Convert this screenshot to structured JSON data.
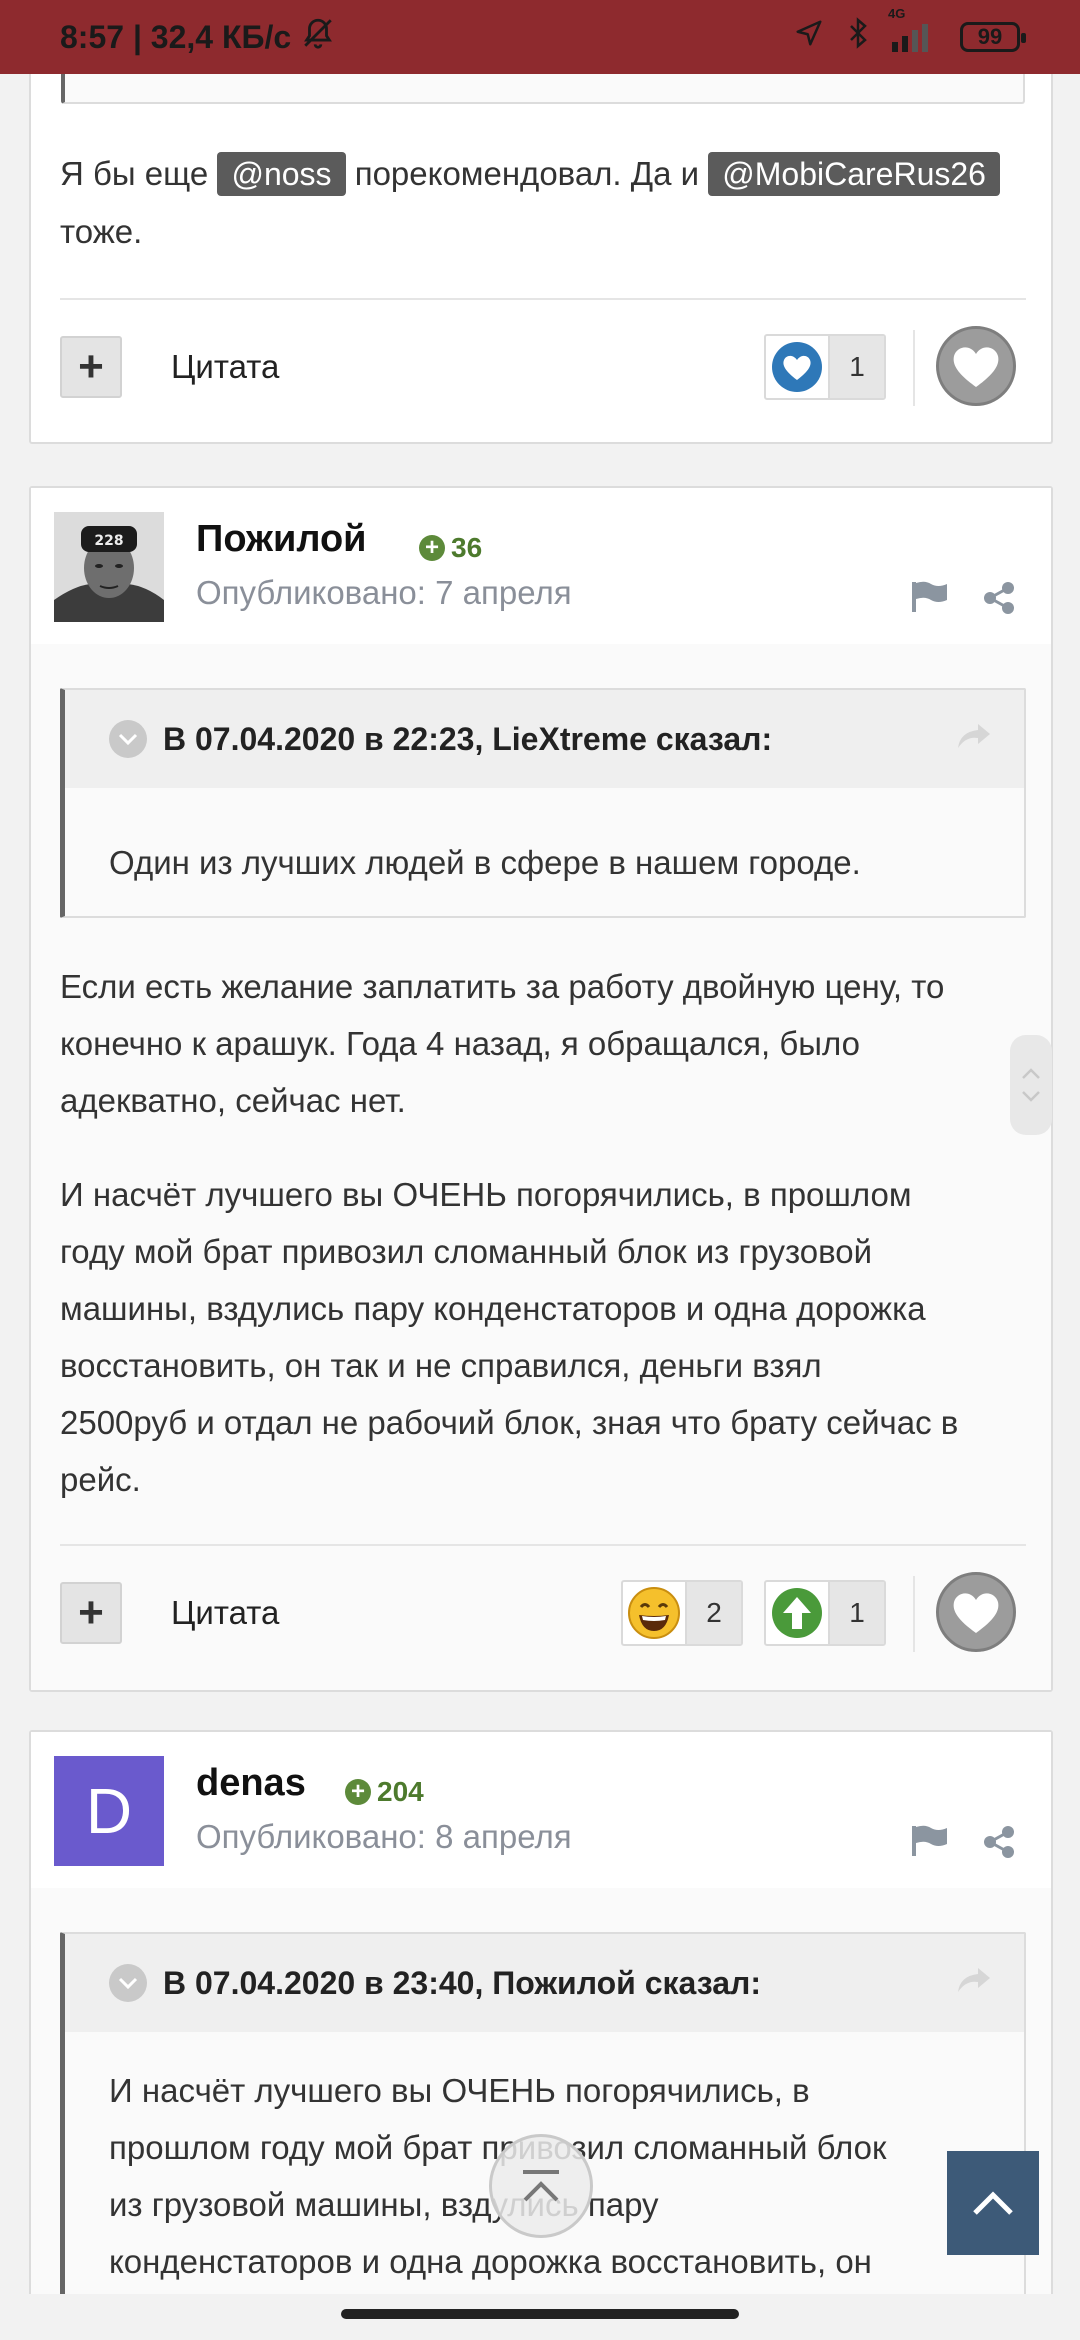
{
  "status_bar": {
    "time_speed": "8:57 | 32,4 КБ/с",
    "network": "4G",
    "battery": "99"
  },
  "post_top": {
    "text_before": "Я бы еще",
    "mention1": "@noss",
    "text_middle": "порекомендовал. Да и",
    "mention2": "@MobiCareRus26",
    "text_after": "тоже.",
    "cite_label": "Цитата",
    "reaction_count": "1"
  },
  "post2": {
    "author": "Пожилой",
    "reputation": "36",
    "published": "Опубликовано: 7 апреля",
    "quote_header": "В 07.04.2020 в 22:23, LieXtreme сказал:",
    "quote_text": "Один из лучших людей в сфере в нашем городе.",
    "paragraph1_lines": [
      "Если есть желание заплатить за работу двойную цену, то",
      "конечно к арашук. Года 4 назад, я обращался, было",
      "адекватно, сейчас нет."
    ],
    "paragraph2_lines": [
      "И насчёт лучшего вы ОЧЕНЬ погорячились, в прошлом",
      "году мой брат привозил сломанный блок из грузовой",
      "машины, вздулись пару конденстаторов и одна дорожка",
      "восстановить, он так и не справился, деньги взял",
      "2500руб и отдал не рабочий блок, зная что брату сейчас в",
      "рейс."
    ],
    "cite_label": "Цитата",
    "reaction_laugh_count": "2",
    "reaction_up_count": "1"
  },
  "post3": {
    "author": "denas",
    "avatar_letter": "D",
    "reputation": "204",
    "published": "Опубликовано: 8 апреля",
    "quote_header": "В 07.04.2020 в 23:40, Пожилой сказал:",
    "quote_lines": [
      "И насчёт лучшего вы ОЧЕНЬ погорячились, в",
      "прошлом году мой брат привозил сломанный блок",
      "из грузовой машины, вздулись пару",
      "конденстаторов и одна дорожка восстановить, он"
    ]
  },
  "colors": {
    "status_bar": "#8e2a2e",
    "accent": "#3d5a78",
    "reputation": "#4d7a2d",
    "avatar_bg": "#6a5acd"
  },
  "icons": [
    "bell-muted-icon",
    "location-icon",
    "bluetooth-icon",
    "signal-icon",
    "battery-icon",
    "heart-icon",
    "laugh-icon",
    "arrow-up-icon",
    "flag-icon",
    "share-icon",
    "chevron-down-icon",
    "reply-arrow-icon",
    "go-top-icon"
  ]
}
